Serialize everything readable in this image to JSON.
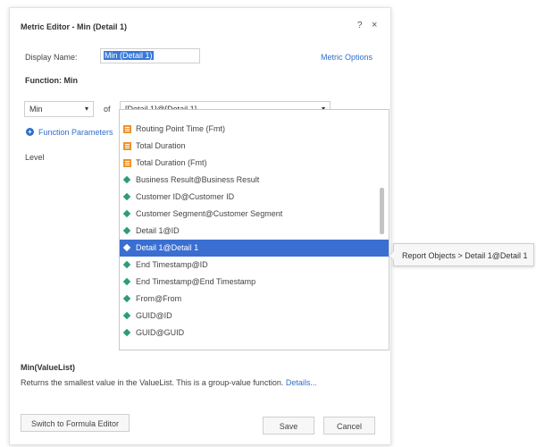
{
  "dialog": {
    "title": "Metric Editor - Min (Detail 1)",
    "help_glyph": "?",
    "close_glyph": "×"
  },
  "display_name": {
    "label": "Display Name:",
    "value": "Min (Detail 1)"
  },
  "metric_options_label": "Metric Options",
  "function_heading": "Function: Min",
  "aggregation": {
    "selected": "Min",
    "caret": "▾"
  },
  "of_label": "of",
  "attribute": {
    "selected": "[Detail 1]@[Detail 1]",
    "caret": "▾"
  },
  "function_parameters_label": "Function Parameters",
  "level_label": "Level",
  "dropdown": {
    "items": [
      {
        "label": "Routing Point Time (Fmt)",
        "icon": "metric-icon"
      },
      {
        "label": "Total Duration",
        "icon": "metric-icon"
      },
      {
        "label": "Total Duration (Fmt)",
        "icon": "metric-icon"
      },
      {
        "label": "Business Result@Business Result",
        "icon": "attribute-icon"
      },
      {
        "label": "Customer ID@Customer ID",
        "icon": "attribute-icon"
      },
      {
        "label": "Customer Segment@Customer Segment",
        "icon": "attribute-icon"
      },
      {
        "label": "Detail 1@ID",
        "icon": "attribute-icon"
      },
      {
        "label": "Detail 1@Detail 1",
        "icon": "attribute-icon",
        "selected": true
      },
      {
        "label": "End Timestamp@ID",
        "icon": "attribute-icon"
      },
      {
        "label": "End Timestamp@End Timestamp",
        "icon": "attribute-icon"
      },
      {
        "label": "From@From",
        "icon": "attribute-icon"
      },
      {
        "label": "GUID@ID",
        "icon": "attribute-icon"
      },
      {
        "label": "GUID@GUID",
        "icon": "attribute-icon"
      }
    ]
  },
  "tooltip": "Report Objects > Detail 1@Detail 1",
  "description": {
    "signature": "Min(ValueList)",
    "text": "Returns the smallest value in the ValueList. This is a group-value function.",
    "details_link": "Details..."
  },
  "buttons": {
    "switch": "Switch to Formula Editor",
    "save": "Save",
    "cancel": "Cancel"
  },
  "colors": {
    "accent": "#2f6fc9",
    "selection": "#3a6fd1",
    "metric_icon": "#f0922b",
    "attribute_icon": "#2e9b7c"
  }
}
